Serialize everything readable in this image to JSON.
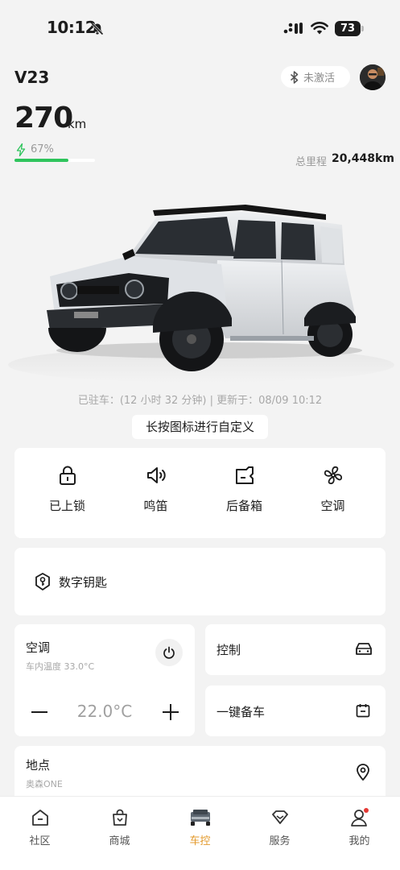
{
  "status_bar": {
    "time": "10:12",
    "battery": "73"
  },
  "header": {
    "car_name": "V23",
    "activation_label": "未激活"
  },
  "range": {
    "value": "270",
    "unit": "km",
    "battery_percent": "67%",
    "battery_level": 0.67
  },
  "odometer": {
    "label": "总里程",
    "value": "20,448km"
  },
  "park_info": "已驻车：(12 小时 32 分钟) | 更新于：08/09 10:12",
  "customize_label": "长按图标进行自定义",
  "quick_actions": [
    {
      "label": "已上锁",
      "icon": "lock-icon"
    },
    {
      "label": "鸣笛",
      "icon": "horn-icon"
    },
    {
      "label": "后备箱",
      "icon": "trunk-icon"
    },
    {
      "label": "空调",
      "icon": "fan-icon"
    }
  ],
  "digital_key": {
    "label": "数字钥匙",
    "icon": "key-shield-icon"
  },
  "ac_card": {
    "title": "空调",
    "subtitle": "车内温度 33.0°C",
    "temperature": "22.0°C"
  },
  "control_card": {
    "label": "控制",
    "icon": "car-front-icon"
  },
  "prep_card": {
    "label": "一键备车",
    "icon": "calendar-icon"
  },
  "location_card": {
    "title": "地点",
    "subtitle": "奥森ONE",
    "icon": "location-pin-icon"
  },
  "tabs": [
    {
      "label": "社区",
      "icon": "home-icon"
    },
    {
      "label": "商城",
      "icon": "shopping-bag-icon"
    },
    {
      "label": "车控",
      "icon": "car-icon"
    },
    {
      "label": "服务",
      "icon": "diamond-icon"
    },
    {
      "label": "我的",
      "icon": "person-icon"
    }
  ],
  "colors": {
    "accent_active": "#e39a2c",
    "battery_green": "#2ec45c",
    "notification_dot": "#e53935"
  }
}
